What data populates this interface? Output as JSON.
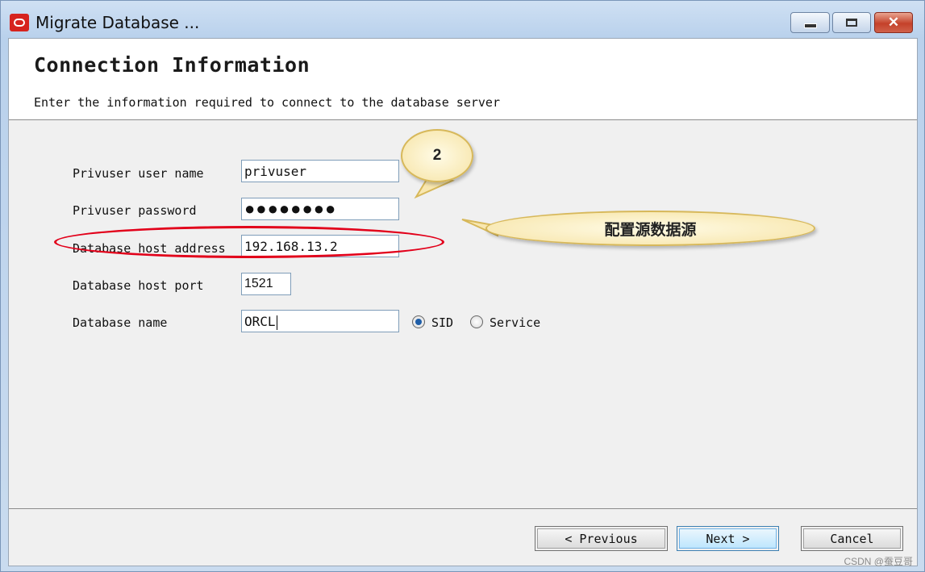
{
  "window": {
    "title": "Migrate Database ...",
    "controls": {
      "minimize": "minimize",
      "maximize": "maximize",
      "close": "✕"
    }
  },
  "header": {
    "title": "Connection Information",
    "subtitle": "Enter the information required to connect to the database server"
  },
  "form": {
    "privuser_name": {
      "label": "Privuser user name",
      "value": "privuser"
    },
    "privuser_password": {
      "label": "Privuser password",
      "value": "●●●●●●●●"
    },
    "host_address": {
      "label": "Database host address",
      "value": "192.168.13.2"
    },
    "host_port": {
      "label": "Database host port",
      "value": "1521"
    },
    "db_name": {
      "label": "Database name",
      "value": "ORCL",
      "options": [
        {
          "label": "SID",
          "selected": true
        },
        {
          "label": "Service",
          "selected": false
        }
      ]
    }
  },
  "annotations": {
    "step_number": "2",
    "banner_text": "配置源数据源",
    "highlight_color": "#e2001a"
  },
  "buttons": {
    "previous": "< Previous",
    "next": "Next >",
    "cancel": "Cancel"
  },
  "watermark": "CSDN @蚕豆哥"
}
